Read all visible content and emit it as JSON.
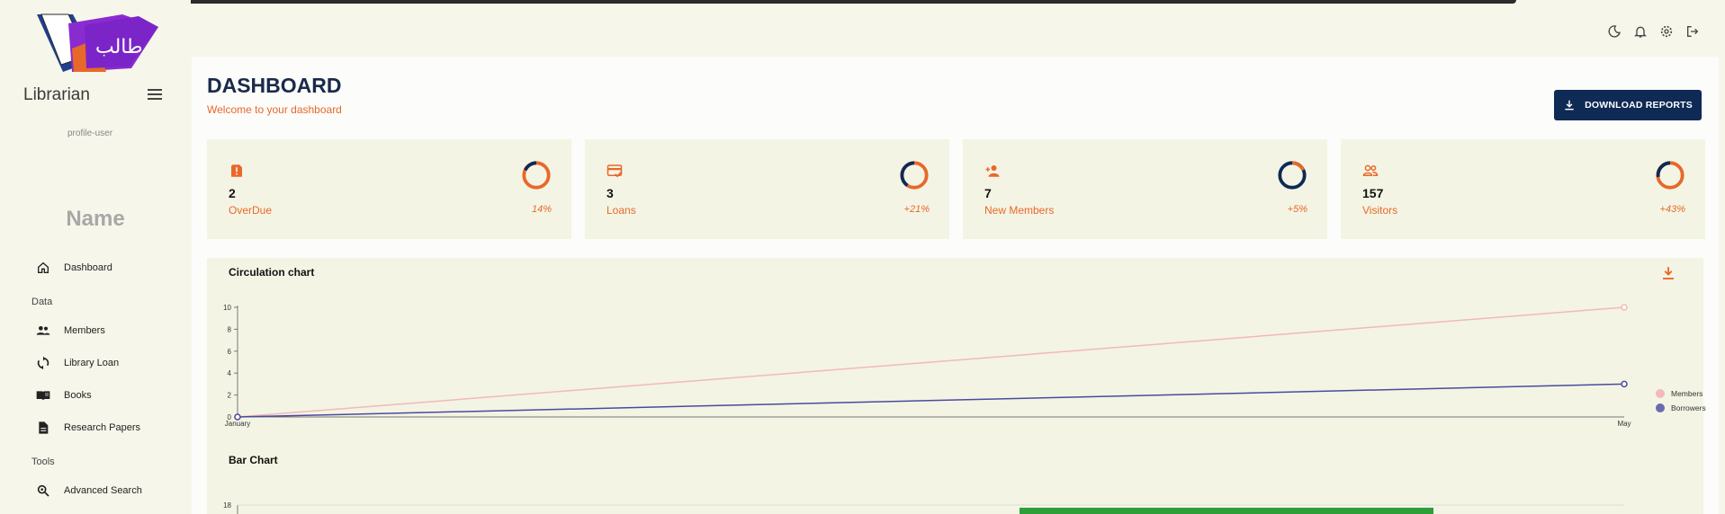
{
  "sidebar": {
    "role": "Librarian",
    "avatar_alt": "profile-user",
    "name": "Name",
    "dashboard": "Dashboard",
    "section_data": "Data",
    "members": "Members",
    "library_loan": "Library Loan",
    "books": "Books",
    "research_papers": "Research Papers",
    "section_tools": "Tools",
    "advanced_search": "Advanced Search"
  },
  "header": {
    "icons": [
      "dark-mode-icon",
      "notifications-icon",
      "settings-icon",
      "logout-icon"
    ]
  },
  "main": {
    "title": "DASHBOARD",
    "subtitle": "Welcome to your dashboard",
    "download_label": "DOWNLOAD REPORTS"
  },
  "stats": [
    {
      "count": "2",
      "label": "OverDue",
      "pct": "14%",
      "icon": "overdue-icon"
    },
    {
      "count": "3",
      "label": "Loans",
      "pct": "+21%",
      "icon": "loans-icon"
    },
    {
      "count": "7",
      "label": "New Members",
      "pct": "+5%",
      "icon": "new-members-icon"
    },
    {
      "count": "157",
      "label": "Visitors",
      "pct": "+43%",
      "icon": "visitors-icon"
    }
  ],
  "colors": {
    "accent": "#e8682a",
    "navy": "#0e2a55",
    "members_line": "#f2b8bd",
    "borrowers_line": "#4a4aa0",
    "bar": "#2e9e3a"
  },
  "chart_data": [
    {
      "type": "line",
      "title": "Circulation chart",
      "x": [
        "January",
        "May"
      ],
      "series": [
        {
          "name": "Members",
          "values": [
            0,
            10
          ]
        },
        {
          "name": "Borrowers",
          "values": [
            0,
            3
          ]
        }
      ],
      "y_ticks": [
        "0",
        "2",
        "4",
        "6",
        "8",
        "10"
      ],
      "ylim": [
        0,
        10
      ],
      "legend": "right"
    },
    {
      "type": "bar",
      "title": "Bar Chart",
      "y_ticks": [
        "18"
      ],
      "ylim": [
        0,
        18
      ]
    }
  ]
}
